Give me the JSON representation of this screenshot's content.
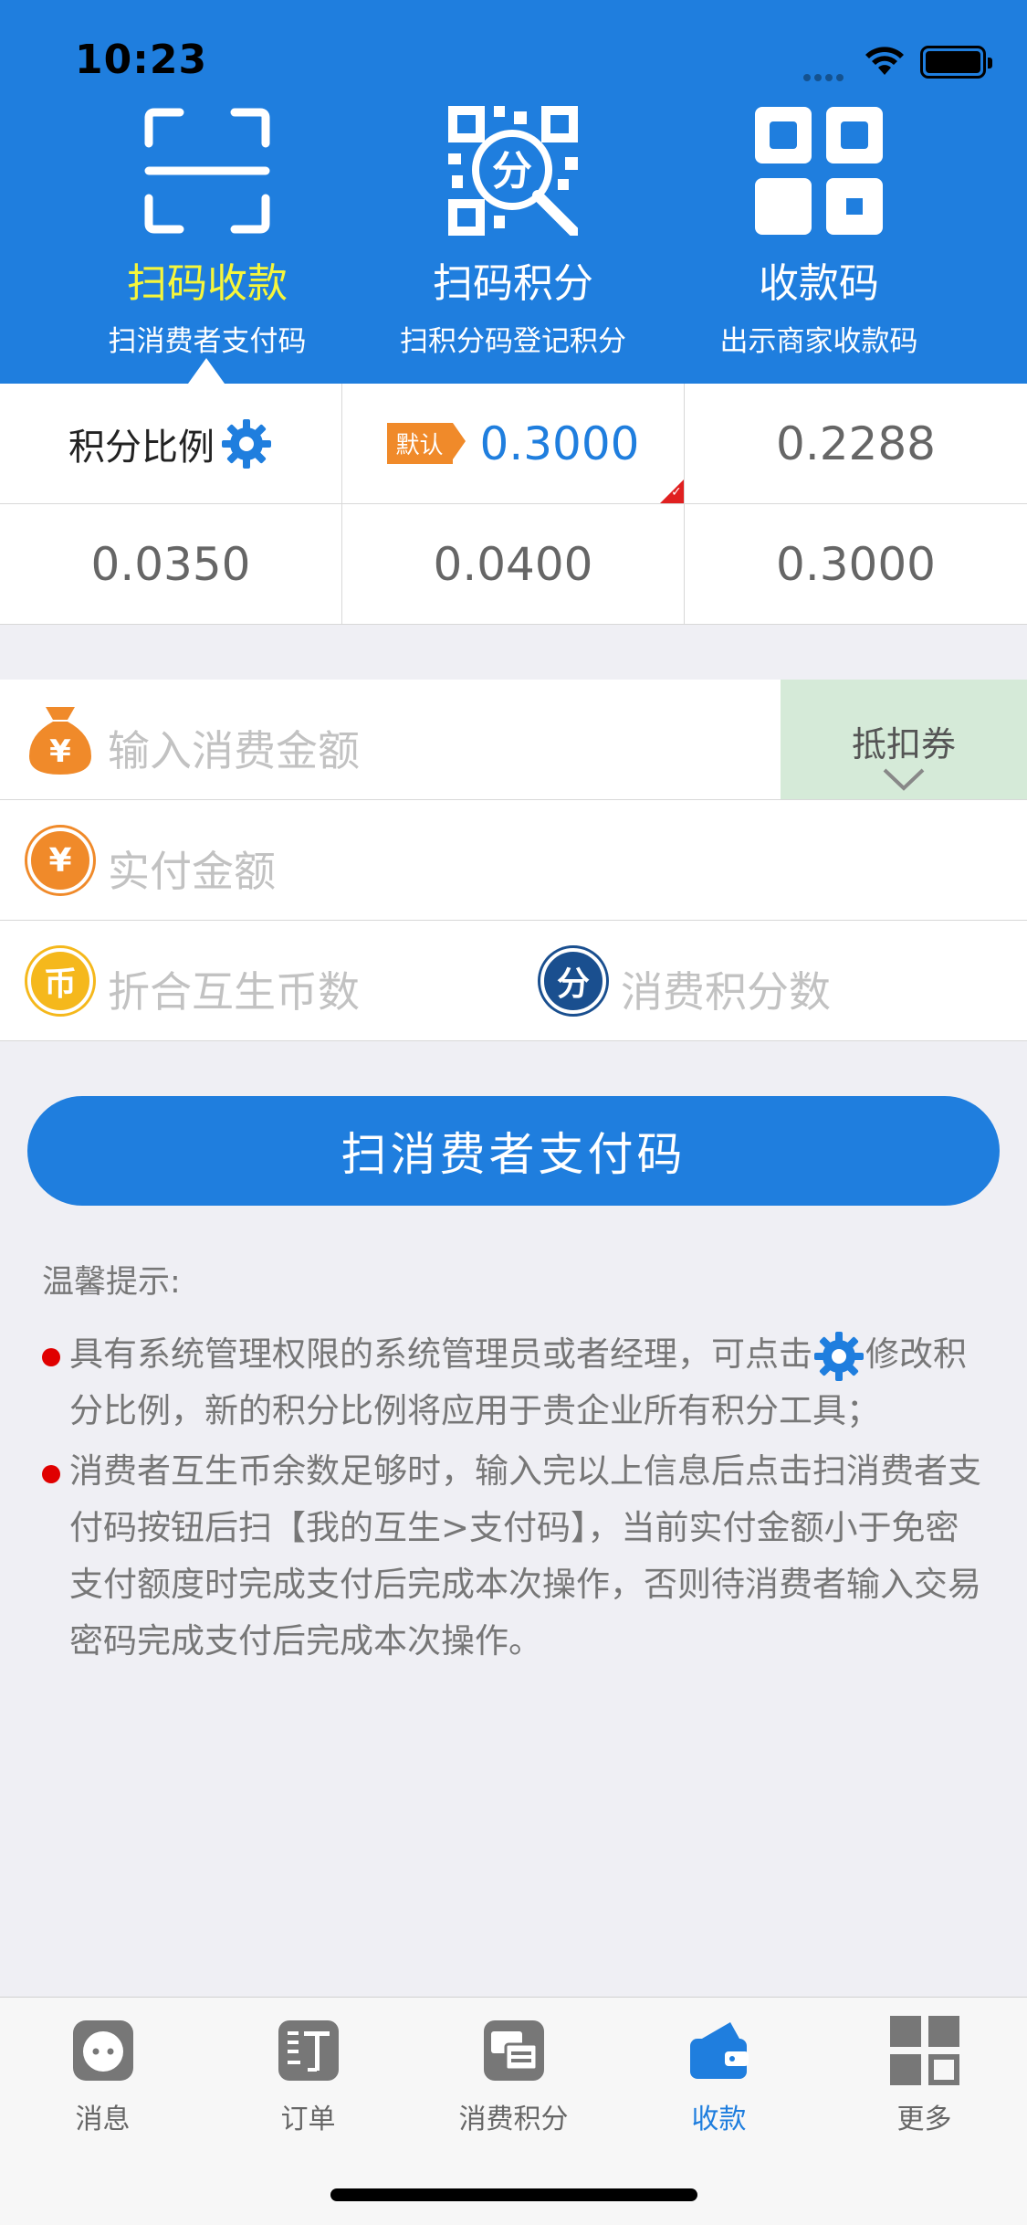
{
  "status": {
    "time": "10:23"
  },
  "actions": [
    {
      "title": "扫码收款",
      "sub": "扫消费者支付码",
      "icon": "scan-frame-icon",
      "active": true
    },
    {
      "title": "扫码积分",
      "sub": "扫积分码登记积分",
      "icon": "qr-points-icon",
      "active": false
    },
    {
      "title": "收款码",
      "sub": "出示商家收款码",
      "icon": "qr-code-icon",
      "active": false
    }
  ],
  "ratio": {
    "label": "积分比例",
    "default_tag": "默认",
    "cells": [
      "0.3000",
      "0.2288",
      "0.0350",
      "0.0400",
      "0.3000"
    ]
  },
  "form": {
    "amount_placeholder": "输入消费金额",
    "coupon_label": "抵扣券",
    "paid_placeholder": "实付金额",
    "coin_placeholder": "折合互生币数",
    "points_placeholder": "消费积分数",
    "yen_glyph": "¥",
    "coin_glyph": "币",
    "points_glyph": "分"
  },
  "submit_label": "扫消费者支付码",
  "tips": {
    "head": "温馨提示:",
    "tip1_a": "具有系统管理权限的系统管理员或者经理，可点击",
    "tip1_b": "修改积分比例，新的积分比例将应用于贵企业所有积分工具；",
    "tip2": "消费者互生币余数足够时，输入完以上信息后点击扫消费者支付码按钮后扫【我的互生>支付码】，当前实付金额小于免密支付额度时完成支付后完成本次操作，否则待消费者输入交易密码完成支付后完成本次操作。"
  },
  "tabs": [
    {
      "label": "消息",
      "icon": "message-icon",
      "active": false
    },
    {
      "label": "订单",
      "icon": "order-icon",
      "active": false
    },
    {
      "label": "消费积分",
      "icon": "points-icon",
      "active": false
    },
    {
      "label": "收款",
      "icon": "wallet-icon",
      "active": true
    },
    {
      "label": "更多",
      "icon": "more-icon",
      "active": false
    }
  ],
  "colors": {
    "primary": "#1f7ede",
    "active_title": "#f6f63b",
    "coupon_bg": "#d5ead8",
    "orange": "#f08a2a",
    "gold": "#f5b81c",
    "navy": "#1a4f8f"
  }
}
